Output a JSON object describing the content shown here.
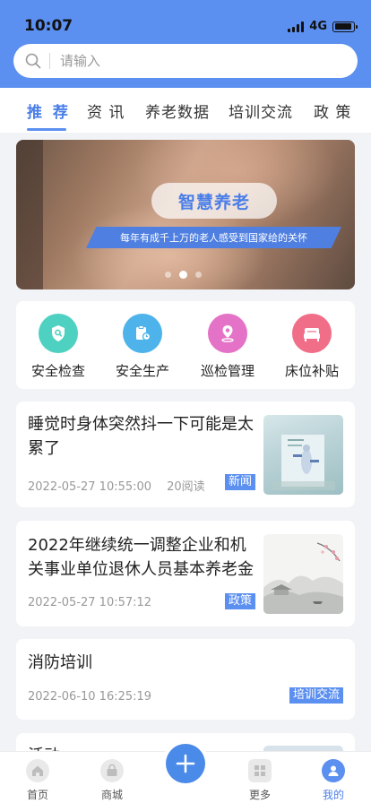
{
  "status_bar": {
    "time": "10:07",
    "network": "4G",
    "battery_level": 0.9
  },
  "search": {
    "placeholder": "请输入"
  },
  "tabs": [
    {
      "label": "推 荐",
      "active": true
    },
    {
      "label": "资 讯",
      "active": false
    },
    {
      "label": "养老数据",
      "active": false
    },
    {
      "label": "培训交流",
      "active": false
    },
    {
      "label": "政 策",
      "active": false
    }
  ],
  "banner": {
    "title": "智慧养老",
    "subtitle": "每年有成千上万的老人感受到国家给的关怀",
    "slide_count": 3,
    "current_slide": 2
  },
  "quick_actions": [
    {
      "label": "安全检查",
      "icon": "shield-search-icon",
      "color": "#4fd1c1"
    },
    {
      "label": "安全生产",
      "icon": "safety-production-icon",
      "color": "#4eb3ea"
    },
    {
      "label": "巡检管理",
      "icon": "location-pin-icon",
      "color": "#e472c6"
    },
    {
      "label": "床位补贴",
      "icon": "bed-icon",
      "color": "#f06e87"
    }
  ],
  "news": [
    {
      "title": "睡觉时身体突然抖一下可能是太累了",
      "date": "2022-05-27 10:55:00",
      "reads": "20阅读",
      "tag": "新闻"
    },
    {
      "title": "2022年继续统一调整企业和机关事业单位退休人员基本养老金",
      "date": "2022-05-27 10:57:12",
      "tag": "政策"
    },
    {
      "title": "消防培训",
      "date": "2022-06-10 16:25:19",
      "tag": "培训交流"
    },
    {
      "title": "活动"
    }
  ],
  "tab_bar": {
    "items": [
      {
        "label": "首页",
        "icon": "home-icon"
      },
      {
        "label": "商城",
        "icon": "shop-icon"
      },
      {
        "label": "更多",
        "icon": "more-grid-icon"
      },
      {
        "label": "我的",
        "icon": "user-icon",
        "active": true
      }
    ],
    "center_button_icon": "plus-icon"
  },
  "colors": {
    "primary": "#5b8ff0",
    "header_bg": "#5b8ff0",
    "page_bg": "#f1f3f6"
  }
}
